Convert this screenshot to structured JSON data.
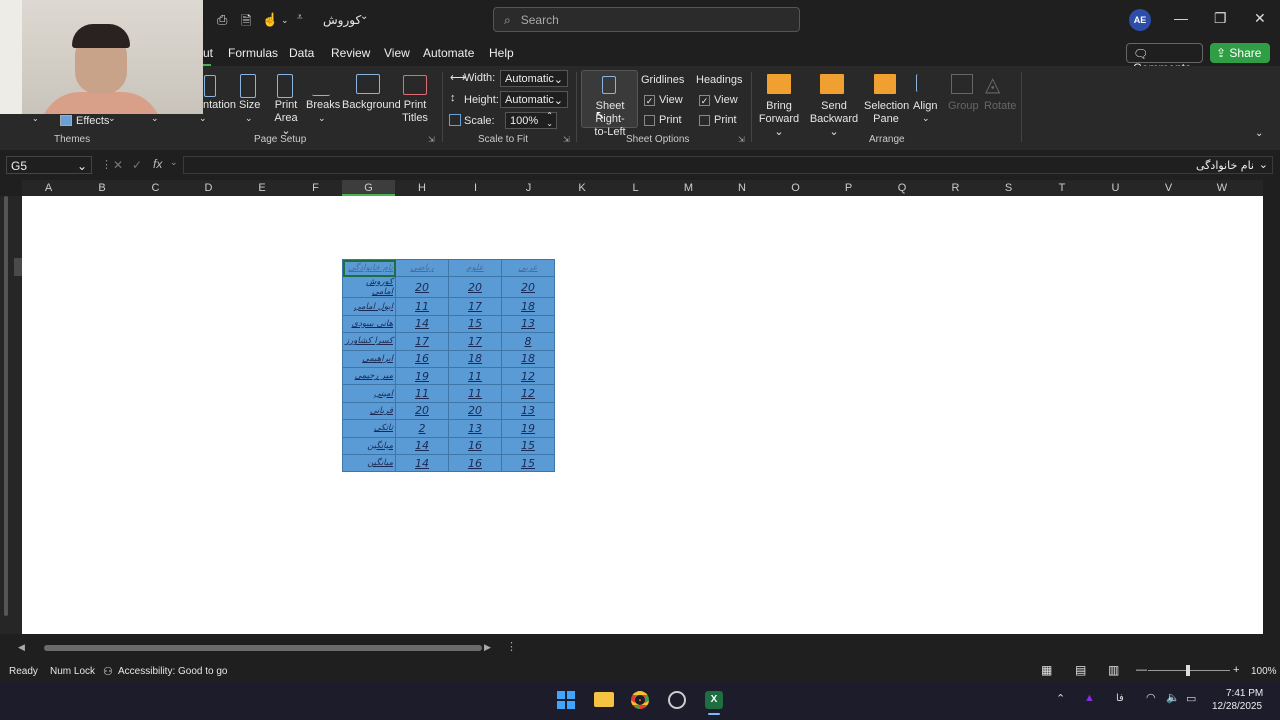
{
  "titlebar": {
    "file_name": "کوروش",
    "search_placeholder": "Search",
    "avatar_initials": "AE"
  },
  "tabs": [
    "ut",
    "Formulas",
    "Data",
    "Review",
    "View",
    "Automate",
    "Help"
  ],
  "actions": {
    "comments": "Comments",
    "share": "Share"
  },
  "ribbon": {
    "themes": {
      "effects": "Effects",
      "group": "Themes"
    },
    "page_setup": {
      "orientation": "ntation",
      "size": "Size",
      "print_area": [
        "Print",
        "Area"
      ],
      "breaks": "Breaks",
      "background": "Background",
      "print_titles": [
        "Print",
        "Titles"
      ],
      "group": "Page Setup"
    },
    "scale_to_fit": {
      "width_label": "Width:",
      "width_value": "Automatic",
      "height_label": "Height:",
      "height_value": "Automatic",
      "scale_label": "Scale:",
      "scale_value": "100%",
      "group": "Scale to Fit"
    },
    "sheet_options": {
      "sheet_rtl": [
        "Sheet Right-",
        "to-Left"
      ],
      "gridlines": "Gridlines",
      "headings": "Headings",
      "view": "View",
      "print": "Print",
      "gridlines_view_checked": true,
      "headings_view_checked": true,
      "group": "Sheet Options"
    },
    "arrange": {
      "bring_forward": [
        "Bring",
        "Forward"
      ],
      "send_backward": [
        "Send",
        "Backward"
      ],
      "selection_pane": [
        "Selection",
        "Pane"
      ],
      "align": "Align",
      "group_btn": "Group",
      "rotate": "Rotate",
      "group": "Arrange"
    }
  },
  "formula_bar": {
    "name_box": "G5",
    "fx": "fx",
    "content": "نام خانوادگی"
  },
  "columns": [
    "A",
    "B",
    "C",
    "D",
    "E",
    "F",
    "G",
    "H",
    "I",
    "J",
    "K",
    "L",
    "M",
    "N",
    "O",
    "P",
    "Q",
    "R",
    "S",
    "T",
    "U",
    "V",
    "W"
  ],
  "table": {
    "headers": [
      "نام خانوادگی",
      "ریاضی",
      "علوم",
      "عربی"
    ],
    "rows": [
      [
        "کوروش امامی",
        "20",
        "20",
        "20"
      ],
      [
        "ابول امامی",
        "11",
        "17",
        "18"
      ],
      [
        "هانی بیبودی",
        "14",
        "15",
        "13"
      ],
      [
        "کسرا کشاورز",
        "17",
        "17",
        "8"
      ],
      [
        "ابراهیمی",
        "16",
        "18",
        "18"
      ],
      [
        "میر رحیمی",
        "19",
        "11",
        "12"
      ],
      [
        "امینی",
        "11",
        "11",
        "12"
      ],
      [
        "قربانی",
        "20",
        "20",
        "13"
      ],
      [
        "تاتکی",
        "2",
        "13",
        "19"
      ],
      [
        "میانگین",
        "14",
        "16",
        "15"
      ],
      [
        "میانگین",
        "14",
        "16",
        "15"
      ]
    ]
  },
  "status": {
    "ready": "Ready",
    "num_lock": "Num Lock",
    "accessibility": "Accessibility: Good to go",
    "zoom": "100%"
  },
  "taskbar": {
    "time": "7:41 PM",
    "date": "12/28/2025",
    "lang": "فا"
  }
}
